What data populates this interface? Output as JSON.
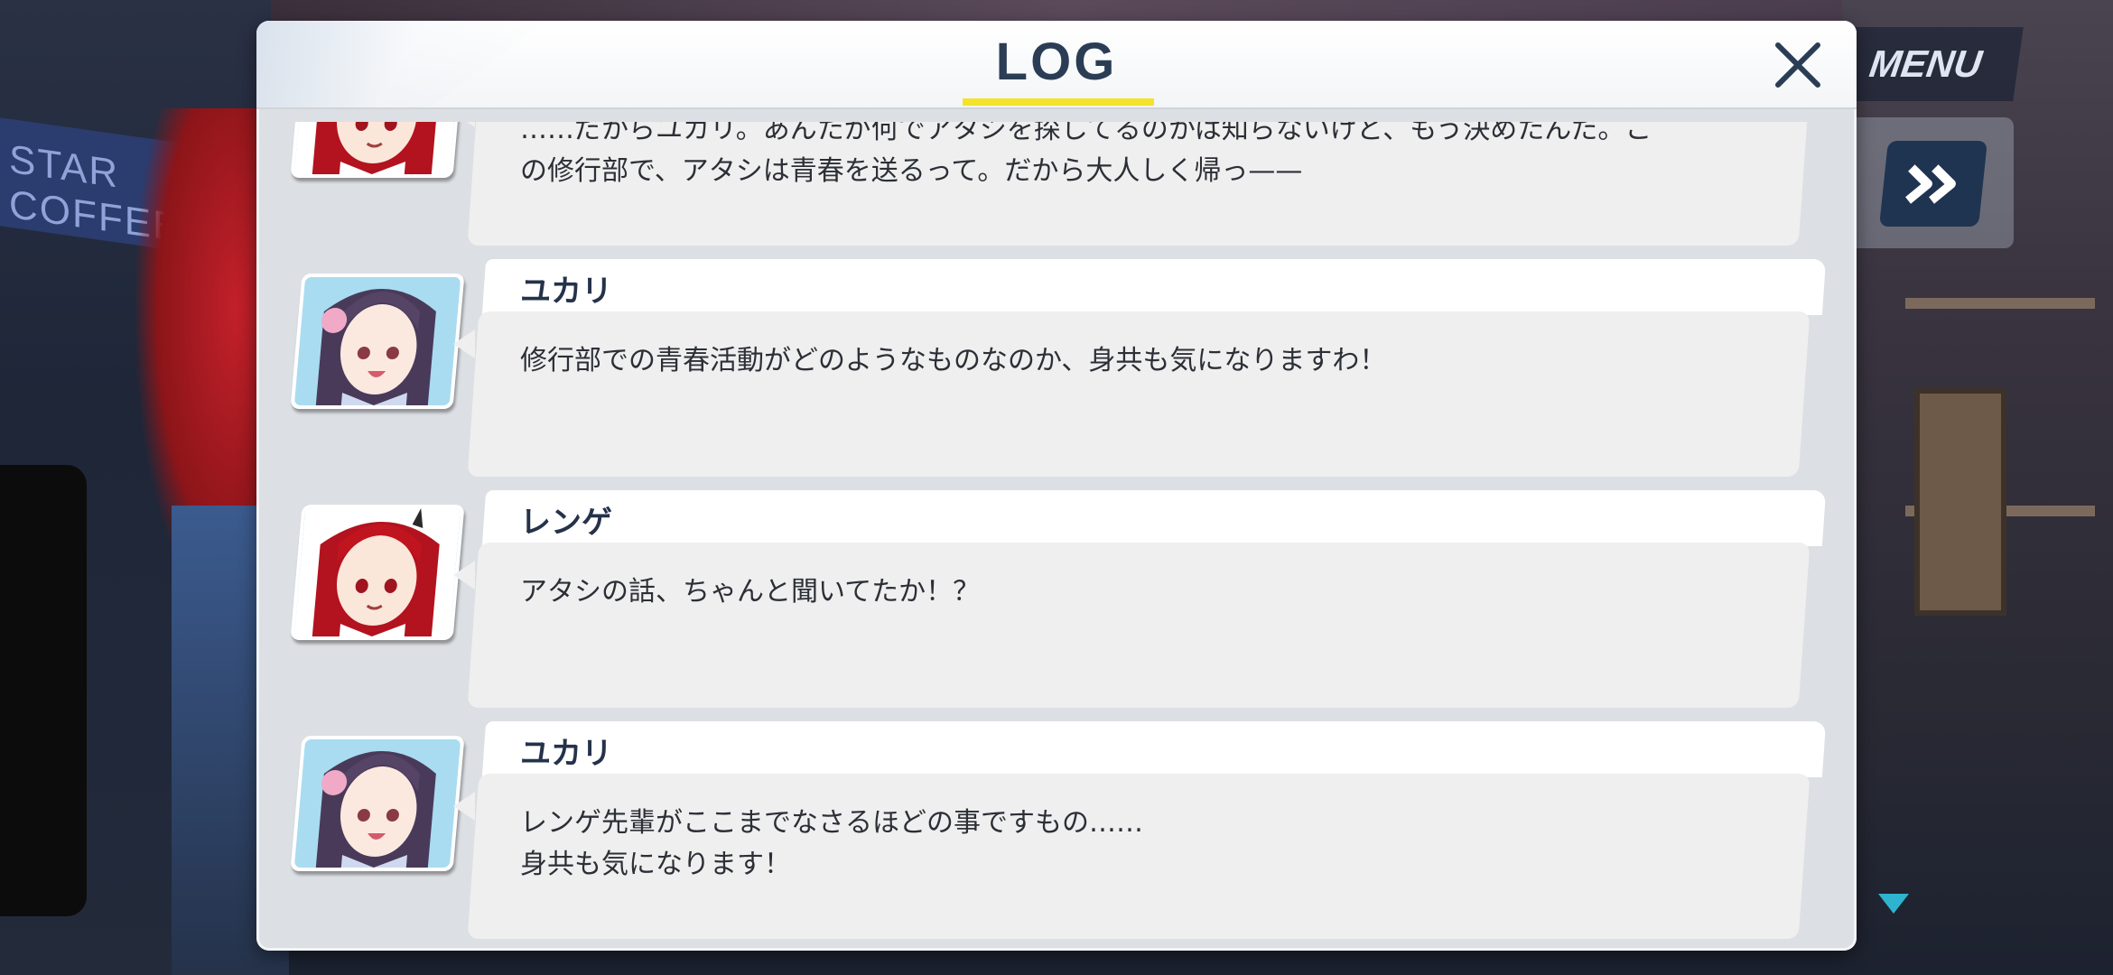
{
  "hud": {
    "menu_label": "MENU",
    "bg_sign_text": "STAR COFFEE"
  },
  "dialog": {
    "title": "LOG",
    "colors": {
      "title": "#2b3d55",
      "underline": "#f3e32a"
    }
  },
  "log": {
    "entries": [
      {
        "speaker": "",
        "portrait": "renge-portrait",
        "text": "……だからユカリ。あんたが何でアタシを探してるのかは知らないけど、もう決めたんだ。こ\nの修行部で、アタシは青春を送るって。だから大人しく帰っ——"
      },
      {
        "speaker": "ユカリ",
        "portrait": "yukari-portrait",
        "text": "修行部での青春活動がどのようなものなのか、身共も気になりますわ！"
      },
      {
        "speaker": "レンゲ",
        "portrait": "renge-portrait",
        "text": "アタシの話、ちゃんと聞いてたか！？"
      },
      {
        "speaker": "ユカリ",
        "portrait": "yukari-portrait",
        "text": "レンゲ先輩がここまでなさるほどの事ですもの……\n身共も気になります！"
      }
    ]
  }
}
